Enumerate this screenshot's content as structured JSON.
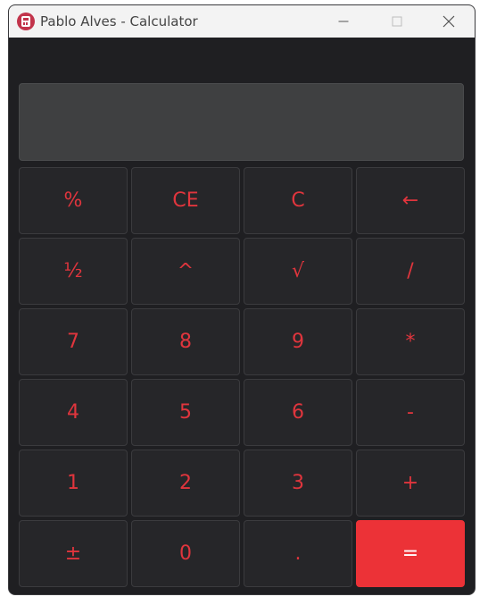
{
  "window": {
    "title": "Pablo Alves - Calculator",
    "icon": "calculator-icon",
    "controls": [
      "minimize-icon",
      "maximize-icon",
      "close-icon"
    ]
  },
  "display": {
    "value": ""
  },
  "keys": [
    {
      "label": "%",
      "name": "key-percent"
    },
    {
      "label": "CE",
      "name": "key-clear-entry"
    },
    {
      "label": "C",
      "name": "key-clear"
    },
    {
      "label": "←",
      "name": "key-backspace"
    },
    {
      "label": "½",
      "name": "key-half"
    },
    {
      "label": "^",
      "name": "key-power"
    },
    {
      "label": "√",
      "name": "key-sqrt"
    },
    {
      "label": "/",
      "name": "key-divide"
    },
    {
      "label": "7",
      "name": "key-7"
    },
    {
      "label": "8",
      "name": "key-8"
    },
    {
      "label": "9",
      "name": "key-9"
    },
    {
      "label": "*",
      "name": "key-multiply"
    },
    {
      "label": "4",
      "name": "key-4"
    },
    {
      "label": "5",
      "name": "key-5"
    },
    {
      "label": "6",
      "name": "key-6"
    },
    {
      "label": "-",
      "name": "key-subtract"
    },
    {
      "label": "1",
      "name": "key-1"
    },
    {
      "label": "2",
      "name": "key-2"
    },
    {
      "label": "3",
      "name": "key-3"
    },
    {
      "label": "+",
      "name": "key-add"
    },
    {
      "label": "±",
      "name": "key-negate"
    },
    {
      "label": "0",
      "name": "key-0"
    },
    {
      "label": ".",
      "name": "key-decimal"
    },
    {
      "label": "=",
      "name": "key-equals"
    }
  ],
  "colors": {
    "accent": "#ec3237",
    "key_text": "#e0353d",
    "window_bg": "#1f1f22",
    "display_bg": "#3f4041",
    "titlebar_bg": "#f3f3f3"
  }
}
